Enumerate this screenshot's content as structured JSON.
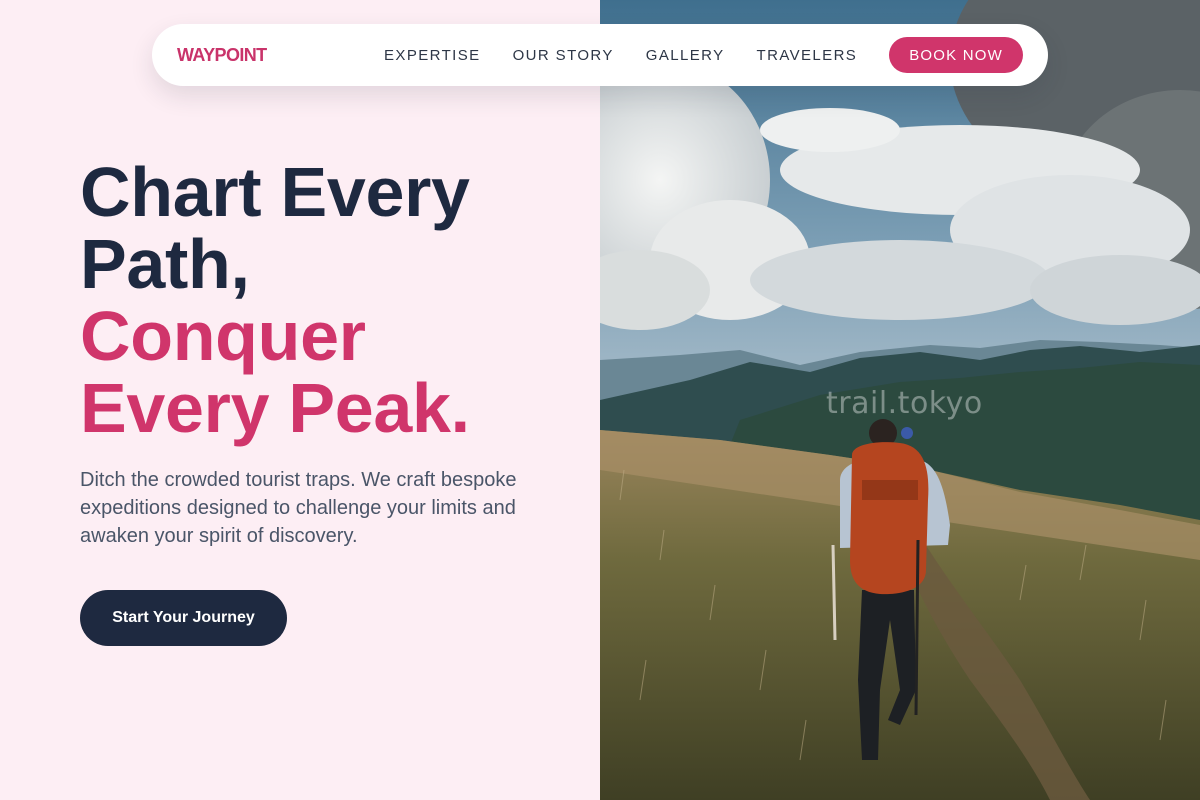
{
  "nav": {
    "logo": "WAYPOINT",
    "links": [
      "EXPERTISE",
      "OUR STORY",
      "GALLERY",
      "TRAVELERS"
    ],
    "book_label": "BOOK NOW"
  },
  "hero": {
    "headline_dark_1": "Chart Every",
    "headline_dark_2": "Path,",
    "headline_pink_1": "Conquer",
    "headline_pink_2": "Every Peak.",
    "description": "Ditch the crowded tourist traps. We craft bespoke expeditions designed to challenge your limits and awaken your spirit of discovery.",
    "cta_label": "Start Your Journey"
  },
  "photo": {
    "watermark": "trail.tokyo"
  },
  "colors": {
    "accent": "#d0356b",
    "dark": "#1e2940",
    "background": "#fdeef4"
  }
}
